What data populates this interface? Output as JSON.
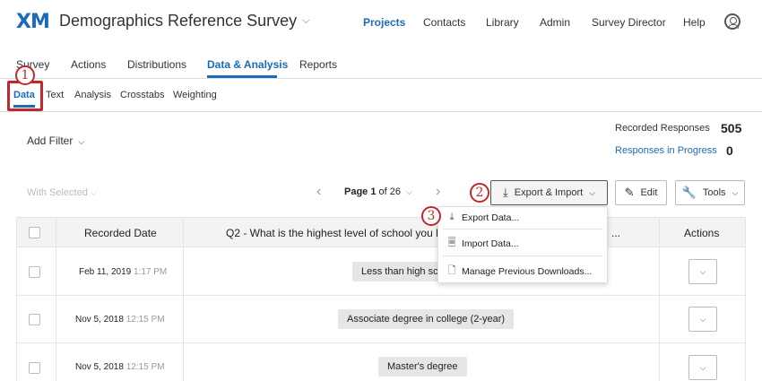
{
  "header": {
    "logo": "XM",
    "survey_title": "Demographics Reference Survey",
    "nav": [
      "Projects",
      "Contacts",
      "Library",
      "Admin",
      "Survey Director",
      "Help"
    ]
  },
  "module_tabs": [
    "Survey",
    "Actions",
    "Distributions",
    "Data & Analysis",
    "Reports"
  ],
  "sub_tabs": [
    "Data",
    "Text",
    "Analysis",
    "Crosstabs",
    "Weighting"
  ],
  "annotations": [
    "1",
    "2",
    "3"
  ],
  "filter": {
    "label": "Add Filter"
  },
  "stats": {
    "recorded_label": "Recorded Responses",
    "recorded_value": "505",
    "progress_label": "Responses in Progress",
    "progress_value": "0"
  },
  "toolbar": {
    "with_selected": "With Selected",
    "page_current": "Page 1",
    "page_of": "of 26",
    "export_label": "Export & Import",
    "edit_label": "Edit",
    "tools_label": "Tools"
  },
  "table": {
    "headers": [
      "Recorded Date",
      "Q2 - What is the highest level of school you h",
      "...",
      "Actions"
    ],
    "rows": [
      {
        "date": "Feb 11, 2019",
        "time": "1:17 PM",
        "answer": "Less than high sch"
      },
      {
        "date": "Nov 5, 2018",
        "time": "12:15 PM",
        "answer": "Associate degree in college (2-year)"
      },
      {
        "date": "Nov 5, 2018",
        "time": "12:15 PM",
        "answer": "Master's degree"
      }
    ]
  },
  "export_menu": {
    "items": [
      "Export Data...",
      "Import Data...",
      "Manage Previous Downloads..."
    ],
    "icons": [
      "download-icon",
      "file-import-icon",
      "documents-icon"
    ]
  },
  "colors": {
    "accent": "#1a6bb8",
    "annotation": "#c0282e"
  }
}
